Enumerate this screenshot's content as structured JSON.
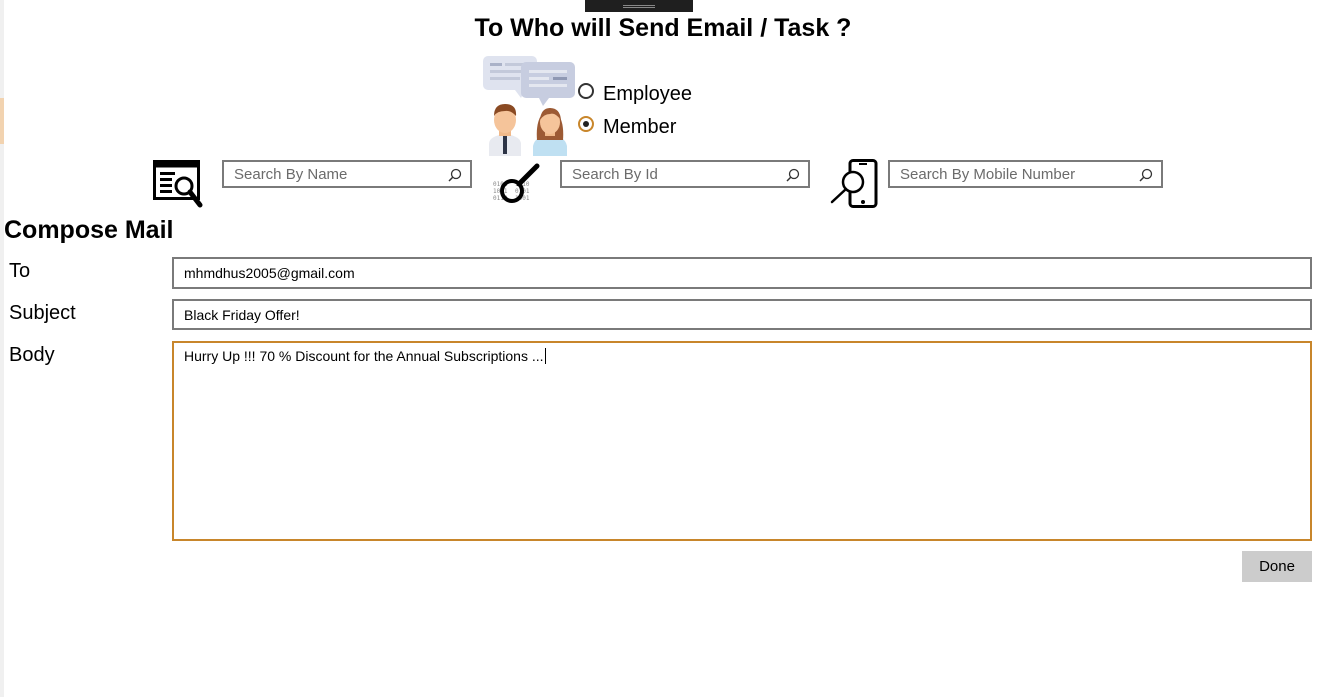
{
  "header": {
    "title": "To Who will Send Email / Task ?"
  },
  "recipient_type": {
    "options": [
      {
        "label": "Employee",
        "checked": false
      },
      {
        "label": "Member",
        "checked": true
      }
    ]
  },
  "search": {
    "by_name_placeholder": "Search By Name",
    "by_id_placeholder": "Search By Id",
    "by_mobile_placeholder": "Search By Mobile Number",
    "name_icon": "id-card-search-icon",
    "id_icon": "binary-magnifier-icon",
    "mobile_icon": "phone-search-icon",
    "field_icon": "magnifier-icon"
  },
  "compose": {
    "title": "Compose Mail",
    "to_label": "To",
    "to_value": "mhmdhus2005@gmail.com",
    "subject_label": "Subject",
    "subject_value": "Black Friday Offer!",
    "body_label": "Body",
    "body_value": "Hurry Up !!! 70 % Discount for the Annual Subscriptions ...",
    "done_label": "Done"
  },
  "colors": {
    "accent": "#c8862b",
    "border": "#7a7a7a",
    "button_bg": "#cccccc"
  }
}
